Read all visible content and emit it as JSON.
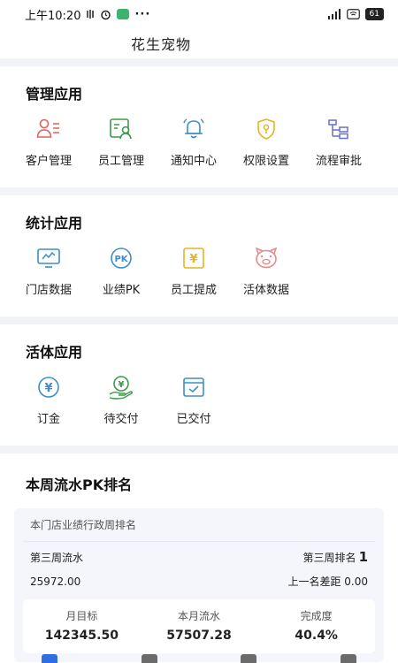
{
  "status_bar": {
    "time": "上午10:20",
    "dots": "···",
    "battery": "61"
  },
  "header": {
    "title": "花生宠物"
  },
  "sections": [
    {
      "title": "管理应用",
      "items": [
        {
          "label": "客户管理",
          "icon": "customer-icon"
        },
        {
          "label": "员工管理",
          "icon": "staff-icon"
        },
        {
          "label": "通知中心",
          "icon": "bell-icon"
        },
        {
          "label": "权限设置",
          "icon": "shield-icon"
        },
        {
          "label": "流程审批",
          "icon": "flow-icon"
        }
      ]
    },
    {
      "title": "统计应用",
      "items": [
        {
          "label": "门店数据",
          "icon": "monitor-icon"
        },
        {
          "label": "业绩PK",
          "icon": "pk-icon",
          "badge": "PK"
        },
        {
          "label": "员工提成",
          "icon": "yen-box-icon",
          "badge": "¥"
        },
        {
          "label": "活体数据",
          "icon": "pig-icon"
        }
      ]
    },
    {
      "title": "活体应用",
      "items": [
        {
          "label": "订金",
          "icon": "yen-circle-icon",
          "badge": "¥"
        },
        {
          "label": "待交付",
          "icon": "yen-hand-icon",
          "badge": "¥"
        },
        {
          "label": "已交付",
          "icon": "check-box-icon"
        }
      ]
    }
  ],
  "ranking": {
    "title": "本周流水PK排名",
    "subtitle": "本门店业绩行政周排名",
    "week_flow_label": "第三周流水",
    "week_rank_label": "第三周排名",
    "week_rank_value": "1",
    "week_flow_value": "25972.00",
    "gap_label": "上一名差距",
    "gap_value": "0.00",
    "stats": [
      {
        "label": "月目标",
        "value": "142345.50"
      },
      {
        "label": "本月流水",
        "value": "57507.28"
      },
      {
        "label": "完成度",
        "value": "40.4%"
      }
    ]
  },
  "colors": {
    "red": "#e0605a",
    "green": "#3a9a4a",
    "blue": "#3d8ec9",
    "yellow": "#e6b422",
    "purple": "#6a6fc8",
    "pink": "#e58a8a",
    "tab_active": "#2e6ee0",
    "tab_inactive": "#6b6b6b"
  }
}
